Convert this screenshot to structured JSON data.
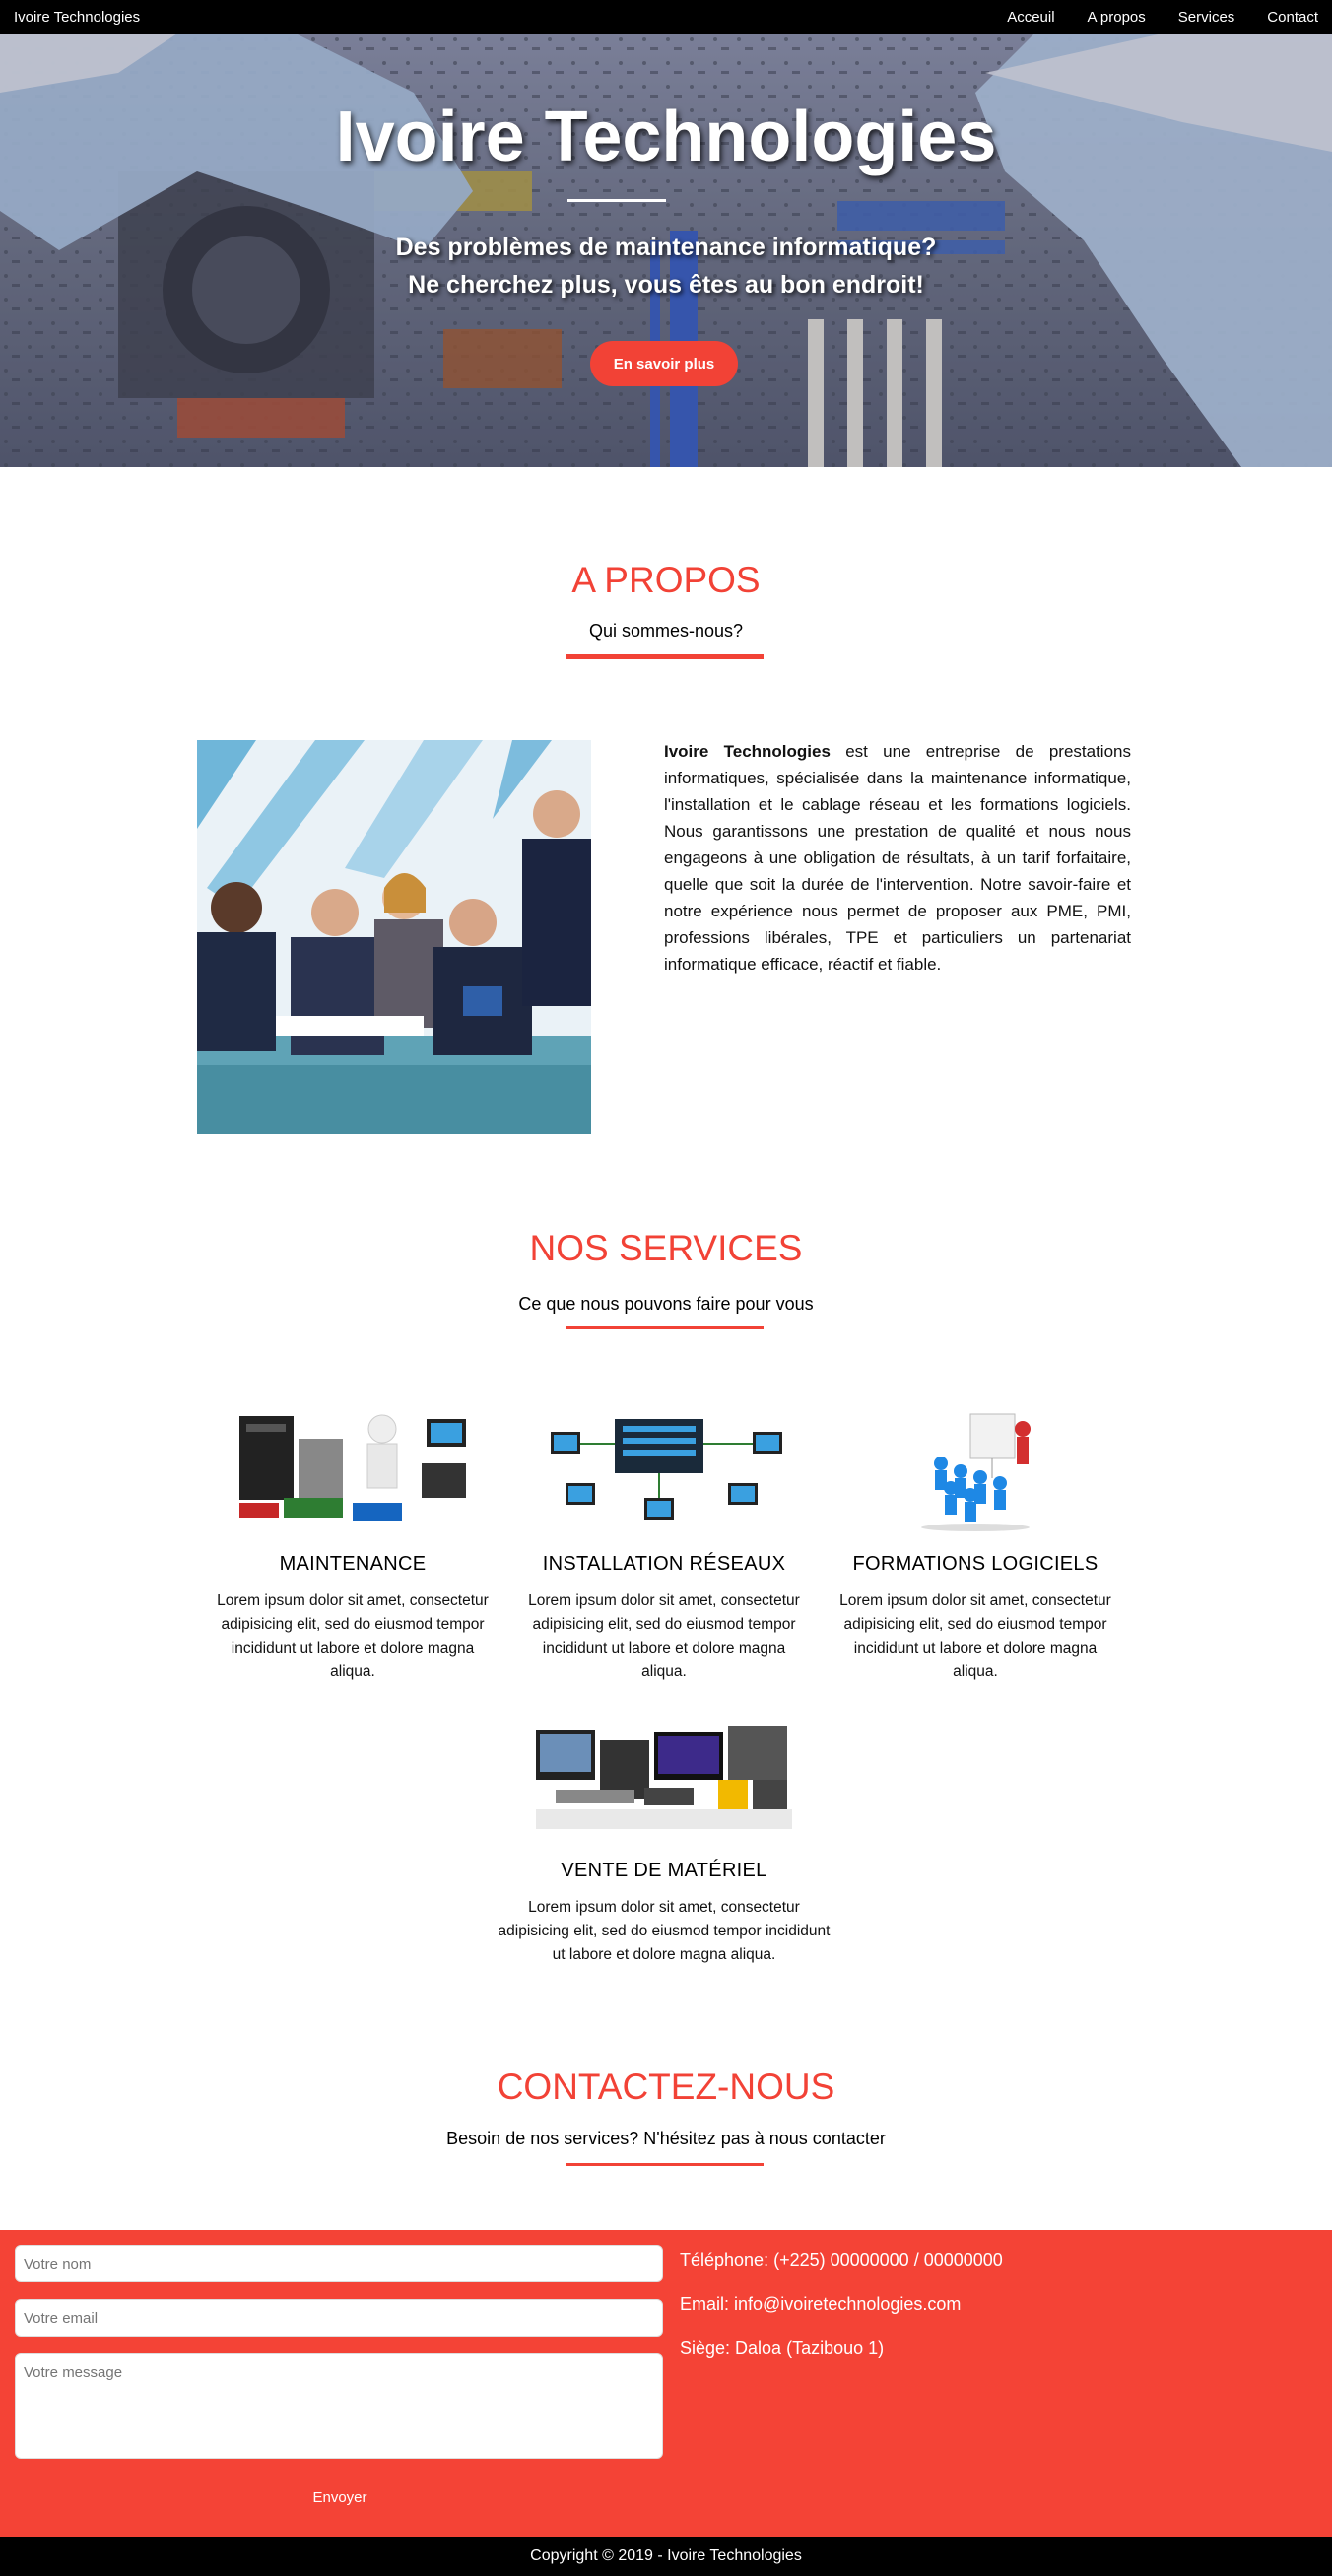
{
  "nav": {
    "brand": "Ivoire Technologies",
    "links": [
      "Acceuil",
      "A propos",
      "Services",
      "Contact"
    ]
  },
  "hero": {
    "title": "Ivoire Technologies",
    "subtitle_1": "Des problèmes de maintenance informatique?",
    "subtitle_2": "Ne cherchez plus, vous êtes au bon endroit!",
    "button": "En savoir plus"
  },
  "about": {
    "title": "A PROPOS",
    "subtitle": "Qui sommes-nous?",
    "company": "Ivoire Technologies",
    "text": " est une entreprise de prestations informatiques, spécialisée dans la maintenance informatique, l'installation et le cablage réseau et les formations logiciels. Nous garantissons une prestation de qualité et nous nous engageons à une obligation de résultats, à un tarif forfaitaire, quelle que soit la durée de l'intervention. Notre savoir-faire et notre expérience nous permet de proposer aux PME, PMI, professions libérales, TPE et particuliers un partenariat informatique efficace, réactif et fiable."
  },
  "services": {
    "title": "NOS SERVICES",
    "subtitle": "Ce que nous pouvons faire pour vous",
    "items": [
      {
        "title": "MAINTENANCE",
        "desc": "Lorem ipsum dolor sit amet, consectetur adipisicing elit, sed do eiusmod tempor incididunt ut labore et dolore magna aliqua."
      },
      {
        "title": "INSTALLATION RÉSEAUX",
        "desc": "Lorem ipsum dolor sit amet, consectetur adipisicing elit, sed do eiusmod tempor incididunt ut labore et dolore magna aliqua."
      },
      {
        "title": "FORMATIONS LOGICIELS",
        "desc": "Lorem ipsum dolor sit amet, consectetur adipisicing elit, sed do eiusmod tempor incididunt ut labore et dolore magna aliqua."
      },
      {
        "title": "VENTE DE MATÉRIEL",
        "desc": "Lorem ipsum dolor sit amet, consectetur adipisicing elit, sed do eiusmod tempor incididunt ut labore et dolore magna aliqua."
      }
    ]
  },
  "contact": {
    "title": "CONTACTEZ-NOUS",
    "subtitle": "Besoin de nos services? N'hésitez pas à nous contacter",
    "name_placeholder": "Votre nom",
    "email_placeholder": "Votre email",
    "message_placeholder": "Votre message",
    "send": "Envoyer",
    "phone": "Téléphone: (+225) 00000000 / 00000000",
    "email": "Email: info@ivoiretechnologies.com",
    "address": "Siège: Daloa (Tazibouo 1)"
  },
  "footer": {
    "copyright": "Copyright © 2019 - Ivoire Technologies"
  },
  "colors": {
    "accent": "#f24236",
    "band": "#f44336",
    "nav": "#000000"
  }
}
